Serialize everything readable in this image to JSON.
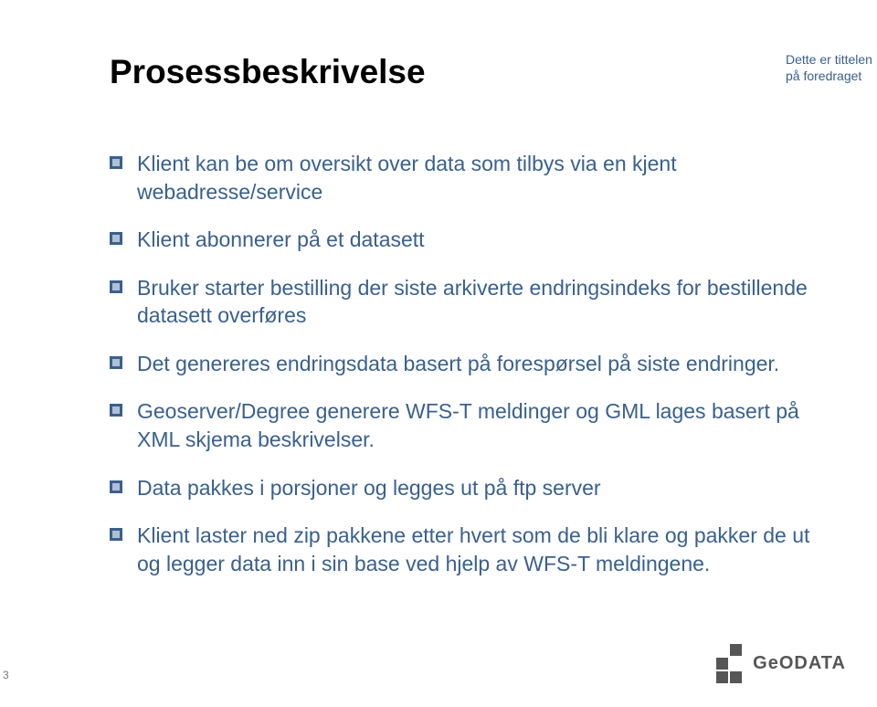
{
  "title": "Prosessbeskrivelse",
  "header_note_line1": "Dette er tittelen",
  "header_note_line2": "på foredraget",
  "bullets": {
    "b0": "Klient kan be om oversikt over data som tilbys via en kjent webadresse/service",
    "b1": "Klient abonnerer på et datasett",
    "b2": "Bruker starter bestilling der siste arkiverte endringsindeks for bestillende datasett overføres",
    "b3": "Det genereres endringsdata basert på forespørsel på siste endringer.",
    "b4": "Geoserver/Degree generere WFS-T meldinger og GML lages basert på XML skjema beskrivelser.",
    "b5": "Data pakkes i porsjoner og legges ut på ftp server",
    "b6": "Klient  laster ned zip pakkene etter hvert som de bli klare og pakker de ut og legger data inn i sin base ved hjelp av WFS-T meldingene."
  },
  "page_number": "3",
  "logo_text": "GeODATA"
}
